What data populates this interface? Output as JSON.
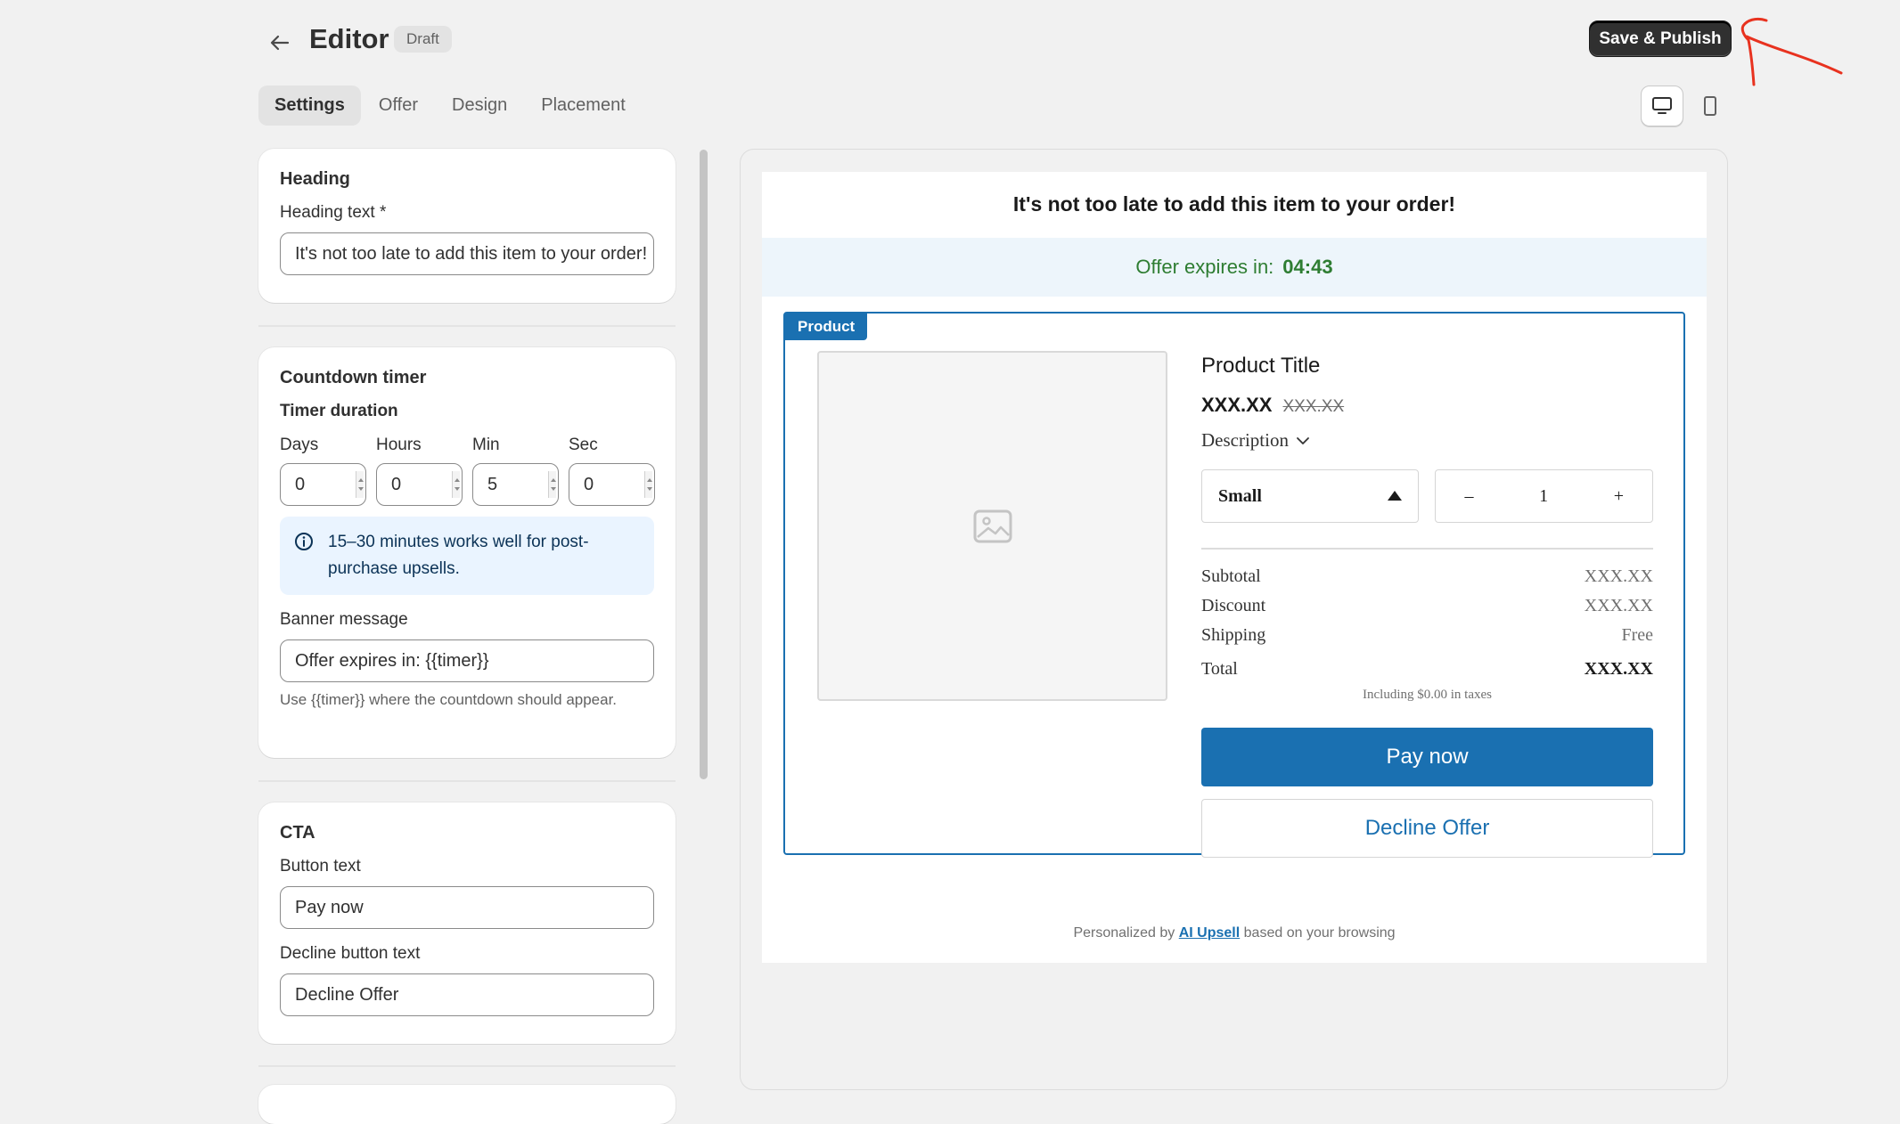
{
  "header": {
    "title": "Editor",
    "status_badge": "Draft",
    "publish_label": "Save & Publish"
  },
  "tabs": [
    {
      "label": "Settings",
      "active": true
    },
    {
      "label": "Offer",
      "active": false
    },
    {
      "label": "Design",
      "active": false
    },
    {
      "label": "Placement",
      "active": false
    }
  ],
  "device_toggle": {
    "selected": "desktop-icon",
    "options": [
      "desktop-icon",
      "mobile-icon"
    ]
  },
  "settings": {
    "heading_card": {
      "title": "Heading",
      "field_label": "Heading text *",
      "value": "It's not too late to add this item to your order!"
    },
    "countdown_card": {
      "title": "Countdown timer",
      "duration_label": "Timer duration",
      "fields": [
        {
          "label": "Days",
          "value": "0"
        },
        {
          "label": "Hours",
          "value": "0"
        },
        {
          "label": "Min",
          "value": "5"
        },
        {
          "label": "Sec",
          "value": "0"
        }
      ],
      "info_text": "15–30 minutes works well for post-purchase upsells.",
      "banner_label": "Banner message",
      "banner_value": "Offer expires in: {{timer}}",
      "banner_help": "Use {{timer}} where the countdown should appear."
    },
    "cta_card": {
      "title": "CTA",
      "button_label": "Button text",
      "button_value": "Pay now",
      "decline_label": "Decline button text",
      "decline_value": "Decline Offer"
    }
  },
  "preview": {
    "heading": "It's not too late to add this item to your order!",
    "timer_prefix": "Offer expires in:",
    "timer_value": "04:43",
    "product_tag": "Product",
    "product_title": "Product Title",
    "price": "XXX.XX",
    "compare_price": "XXX.XX",
    "description_label": "Description",
    "variant": "Small",
    "quantity": "1",
    "qty_minus": "–",
    "qty_plus": "+",
    "summary": [
      {
        "label": "Subtotal",
        "value": "XXX.XX"
      },
      {
        "label": "Discount",
        "value": "XXX.XX"
      },
      {
        "label": "Shipping",
        "value": "Free"
      }
    ],
    "total_label": "Total",
    "total_value": "XXX.XX",
    "tax_note": "Including $0.00 in taxes",
    "pay_label": "Pay now",
    "decline_label": "Decline Offer",
    "footer_prefix": "Personalized by",
    "footer_link": "AI Upsell",
    "footer_suffix": "based on your browsing"
  },
  "colors": {
    "accent": "#1a70b1",
    "timer_green": "#2e7d32",
    "publish_button": "#303030",
    "annotation": "#e8321f"
  }
}
